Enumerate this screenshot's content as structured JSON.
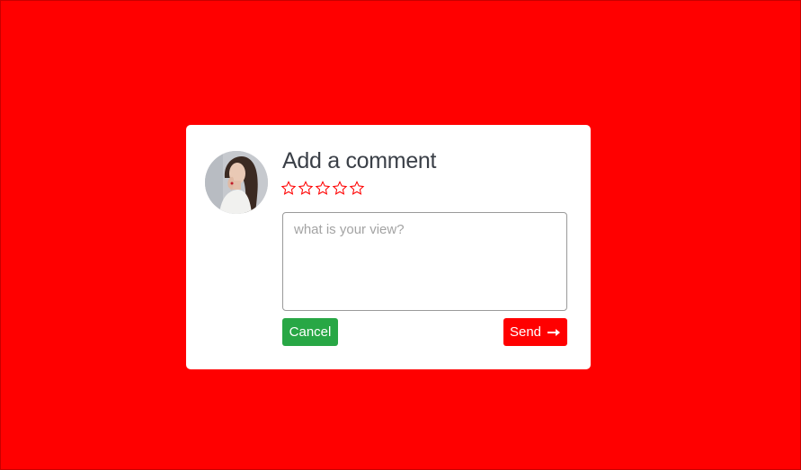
{
  "comment_form": {
    "title": "Add a comment",
    "rating": {
      "value": 0,
      "max": 5,
      "stars": [
        "star-1",
        "star-2",
        "star-3",
        "star-4",
        "star-5"
      ]
    },
    "textarea": {
      "placeholder": "what is your view?",
      "value": ""
    },
    "cancel_label": "Cancel",
    "send_label": "Send",
    "send_icon": "arrow-right-icon",
    "avatar_icon": "user-avatar"
  },
  "colors": {
    "background": "#ff0000",
    "card": "#ffffff",
    "cancel_button": "#28a745",
    "send_button": "#ff0000",
    "star_outline": "#ff0000",
    "title_text": "#3a3f47"
  }
}
